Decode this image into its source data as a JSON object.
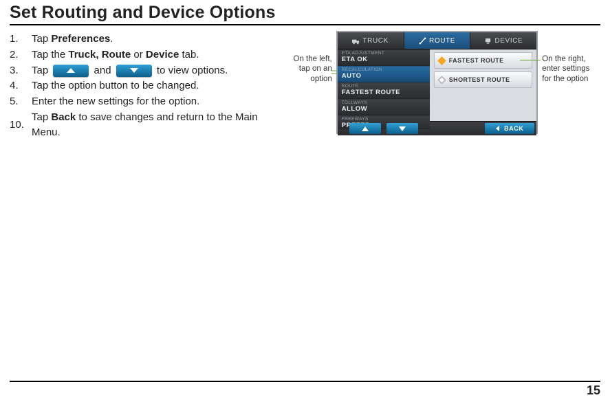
{
  "title": "Set Routing and Device Options",
  "steps": [
    {
      "num": "1.",
      "pre": "Tap ",
      "bold": "Preferences",
      "post": "."
    },
    {
      "num": "2.",
      "pre": "Tap the ",
      "bold": "Truck, Route",
      "mid": " or ",
      "bold2": "Device",
      "post": " tab."
    },
    {
      "num": "3.",
      "pre": "Tap ",
      "icon1": true,
      "mid": " and ",
      "icon2": true,
      "post": " to view options."
    },
    {
      "num": "4.",
      "pre": "Tap the option button to be changed."
    },
    {
      "num": "5.",
      "pre": "Enter the new settings for the option."
    },
    {
      "num": "10.",
      "pre": "Tap ",
      "bold": "Back",
      "post": " to save changes and return to the Main Menu."
    }
  ],
  "callouts": {
    "left": "On the left, tap on an option",
    "right": "On the right, enter settings for the option"
  },
  "device": {
    "tabs": [
      "TRUCK",
      "ROUTE",
      "DEVICE"
    ],
    "activeTab": 1,
    "options": [
      {
        "label": "ETA ADJUSTMENT",
        "value": "ETA OK"
      },
      {
        "label": "RECALCULATION",
        "value": "AUTO"
      },
      {
        "label": "ROUTE",
        "value": "FASTEST ROUTE"
      },
      {
        "label": "TOLLWAYS",
        "value": "ALLOW"
      },
      {
        "label": "FREEWAYS",
        "value": "PREFER"
      }
    ],
    "selectedOption": 1,
    "choices": [
      {
        "label": "FASTEST ROUTE",
        "selected": true
      },
      {
        "label": "SHORTEST ROUTE",
        "selected": false
      }
    ],
    "back": "BACK"
  },
  "pageNumber": "15"
}
